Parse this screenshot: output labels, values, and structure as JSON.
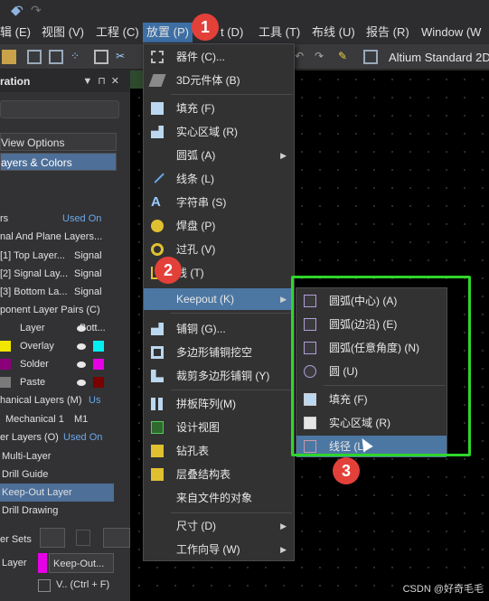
{
  "menubar": {
    "items": [
      {
        "label": "辑 (E)"
      },
      {
        "label": "视图 (V)"
      },
      {
        "label": "工程 (C)"
      },
      {
        "label": "放置 (P)"
      },
      {
        "label": "t (D)"
      },
      {
        "label": "工具 (T)"
      },
      {
        "label": "布线 (U)"
      },
      {
        "label": "报告 (R)"
      },
      {
        "label": "Window (W"
      }
    ]
  },
  "toolbar": {
    "profile_text": "Altium Standard 2D"
  },
  "panel": {
    "title": "ration",
    "view_options": "View Options",
    "layers_colors": "ayers & Colors",
    "header": {
      "col1": "rs",
      "col2": "Used On"
    },
    "rows": [
      {
        "text": "nal And Plane Layers..."
      },
      {
        "text": "[1] Top Layer...",
        "right": "Signal"
      },
      {
        "text": "[2] Signal Lay...",
        "right": "Signal"
      },
      {
        "text": "[3] Bottom La...",
        "right": "Signal"
      },
      {
        "text": "ponent Layer Pairs (C)"
      },
      {
        "text": "Layer",
        "right": "Bott..."
      },
      {
        "text": "Overlay"
      },
      {
        "text": "Solder"
      },
      {
        "text": "Paste"
      },
      {
        "text": "hanical Layers (M)",
        "right": "Us"
      },
      {
        "text": "Mechanical 1",
        "right": "M1"
      },
      {
        "text": "er Layers (O)",
        "right": "Used On"
      },
      {
        "text": "Multi-Layer"
      },
      {
        "text": "Drill Guide"
      },
      {
        "text": "Keep-Out Layer"
      },
      {
        "text": "Drill Drawing"
      }
    ],
    "layer_sets": "er Sets",
    "layer_label": "Layer",
    "layer_select": "Keep-Out...",
    "checkbox_label": "V.. (Ctrl + F)"
  },
  "dropdown": {
    "items": [
      {
        "label": "器件 (C)..."
      },
      {
        "label": "3D元件体 (B)"
      },
      {
        "label": "填充 (F)"
      },
      {
        "label": "实心区域 (R)"
      },
      {
        "label": "圆弧 (A)"
      },
      {
        "label": "线条 (L)"
      },
      {
        "label": "字符串 (S)"
      },
      {
        "label": "焊盘 (P)"
      },
      {
        "label": "过孔 (V)"
      },
      {
        "label": "线 (T)"
      },
      {
        "label": "Keepout (K)"
      },
      {
        "label": "铺铜 (G)..."
      },
      {
        "label": "多边形铺铜挖空"
      },
      {
        "label": "裁剪多边形铺铜 (Y)"
      },
      {
        "label": "拼板阵列(M)"
      },
      {
        "label": "设计视图"
      },
      {
        "label": "钻孔表"
      },
      {
        "label": "层叠结构表"
      },
      {
        "label": "来自文件的对象"
      },
      {
        "label": "尺寸 (D)"
      },
      {
        "label": "工作向导 (W)"
      }
    ]
  },
  "submenu": {
    "items": [
      {
        "label": "圆弧(中心) (A)"
      },
      {
        "label": "圆弧(边沿) (E)"
      },
      {
        "label": "圆弧(任意角度) (N)"
      },
      {
        "label": "圆 (U)"
      },
      {
        "label": "填充 (F)"
      },
      {
        "label": "实心区域 (R)"
      },
      {
        "label": "线径 (L)"
      }
    ]
  },
  "badges": {
    "one": "1",
    "two": "2",
    "three": "3"
  },
  "watermark": "CSDN @好奇毛毛",
  "colors": {
    "accent": "#4c77a3",
    "highlight_box": "#2fd62a",
    "badge": "#e3403a"
  }
}
